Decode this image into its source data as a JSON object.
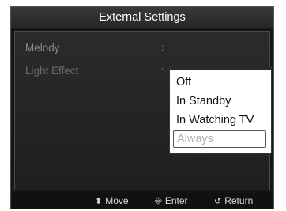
{
  "window": {
    "title": "External Settings"
  },
  "settings": [
    {
      "label": "Melody",
      "separator": ":"
    },
    {
      "label": "Light Effect",
      "separator": ":"
    }
  ],
  "dropdown": {
    "options": [
      "Off",
      "In Standby",
      "In Watching TV",
      "Always"
    ],
    "highlighted_index": 3
  },
  "footer": {
    "move": {
      "icon": "up-down-arrow-icon",
      "glyph": "⬍",
      "label": "Move"
    },
    "enter": {
      "icon": "enter-icon",
      "glyph": "⎆",
      "label": "Enter"
    },
    "return": {
      "icon": "return-icon",
      "glyph": "↺",
      "label": "Return"
    }
  },
  "colors": {
    "background": "#161616",
    "dropdown_bg": "#ffffff",
    "highlight_text": "#b0b0b0"
  }
}
